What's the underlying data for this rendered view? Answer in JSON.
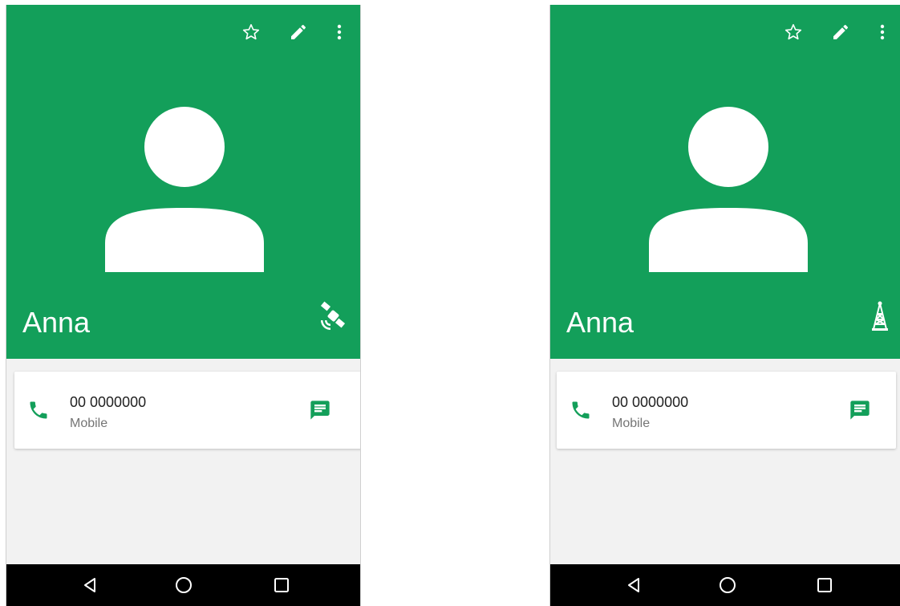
{
  "screens": [
    {
      "contact": {
        "name": "Anna",
        "network_icon": "satellite-icon"
      },
      "toolbar": {
        "favorite_icon": "star-outline-icon",
        "edit_icon": "pencil-icon",
        "more_icon": "more-vert-icon"
      },
      "phone_entry": {
        "number": "00 0000000",
        "type": "Mobile",
        "call_icon": "phone-icon",
        "message_icon": "message-icon"
      }
    },
    {
      "contact": {
        "name": "Anna",
        "network_icon": "cell-tower-icon"
      },
      "toolbar": {
        "favorite_icon": "star-outline-icon",
        "edit_icon": "pencil-icon",
        "more_icon": "more-vert-icon"
      },
      "phone_entry": {
        "number": "00 0000000",
        "type": "Mobile",
        "call_icon": "phone-icon",
        "message_icon": "message-icon"
      }
    }
  ],
  "navigation": {
    "back": "back-icon",
    "home": "home-icon",
    "recents": "recents-icon"
  },
  "colors": {
    "header_green": "#139f5a",
    "background": "#f2f2f2",
    "nav_bar": "#000000",
    "text_primary": "#212121",
    "text_secondary": "#757575"
  }
}
